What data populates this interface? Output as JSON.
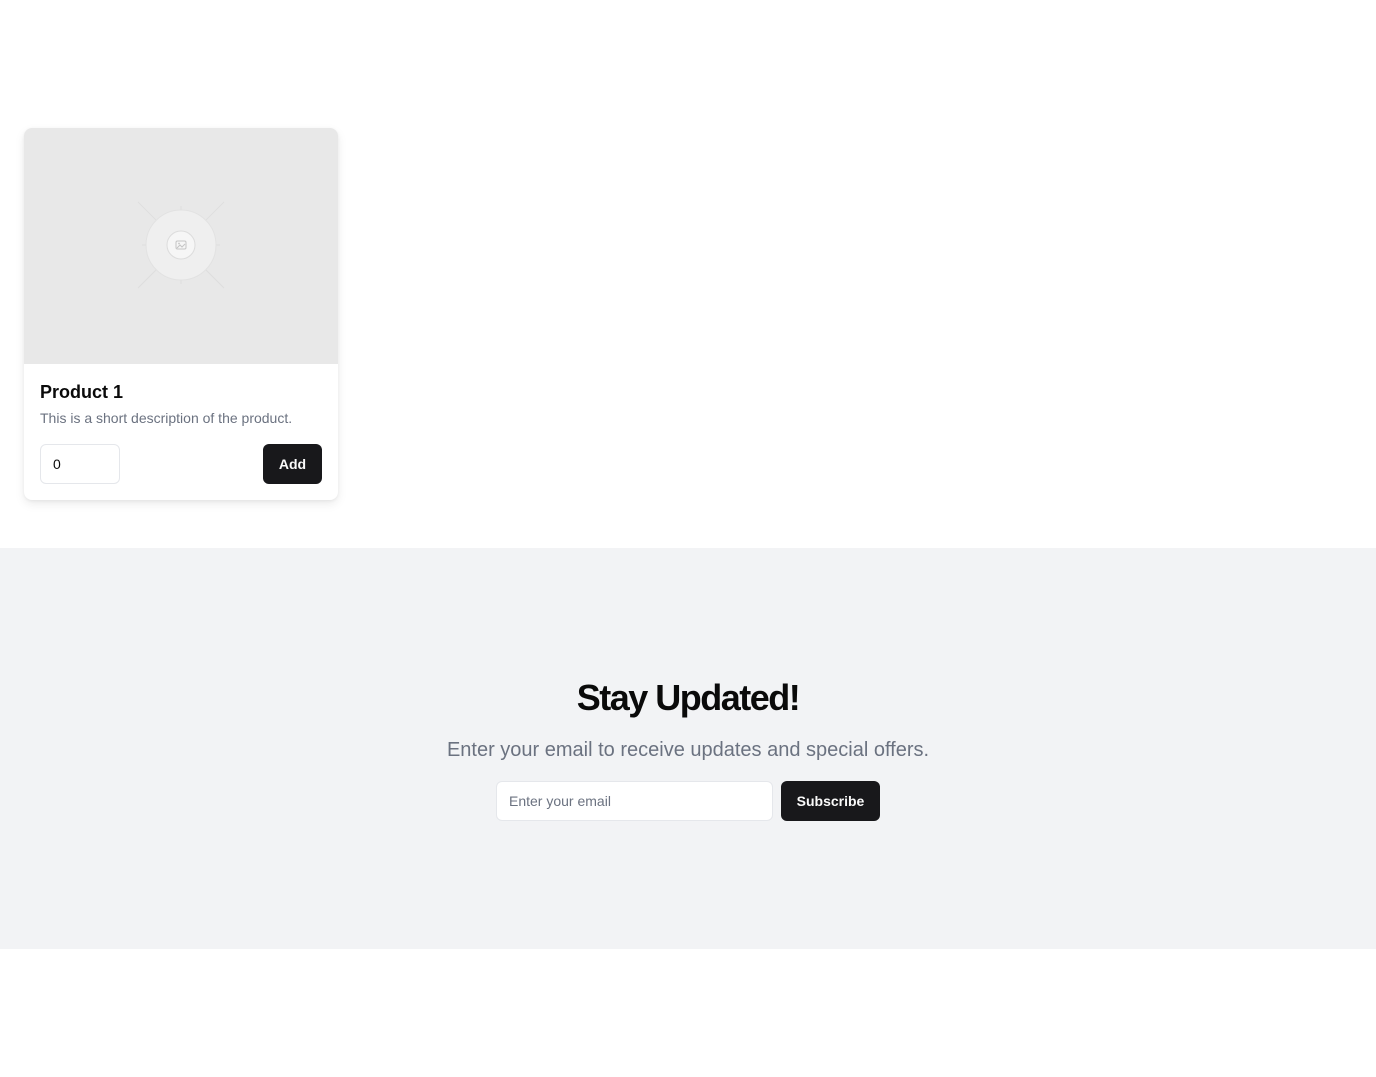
{
  "products": [
    {
      "title": "Product 1",
      "description": "This is a short description of the product.",
      "quantity_value": "0",
      "add_label": "Add",
      "image_icon": "image-placeholder-icon"
    }
  ],
  "newsletter": {
    "title": "Stay Updated!",
    "subtitle": "Enter your email to receive updates and special offers.",
    "email_placeholder": "Enter your email",
    "subscribe_label": "Subscribe"
  },
  "colors": {
    "page_background": "#ffffff",
    "newsletter_background": "#f2f3f5",
    "image_placeholder": "#e8e8e8",
    "button_background": "#18181b",
    "button_text": "#fafafa",
    "muted_text": "#6b7280"
  }
}
